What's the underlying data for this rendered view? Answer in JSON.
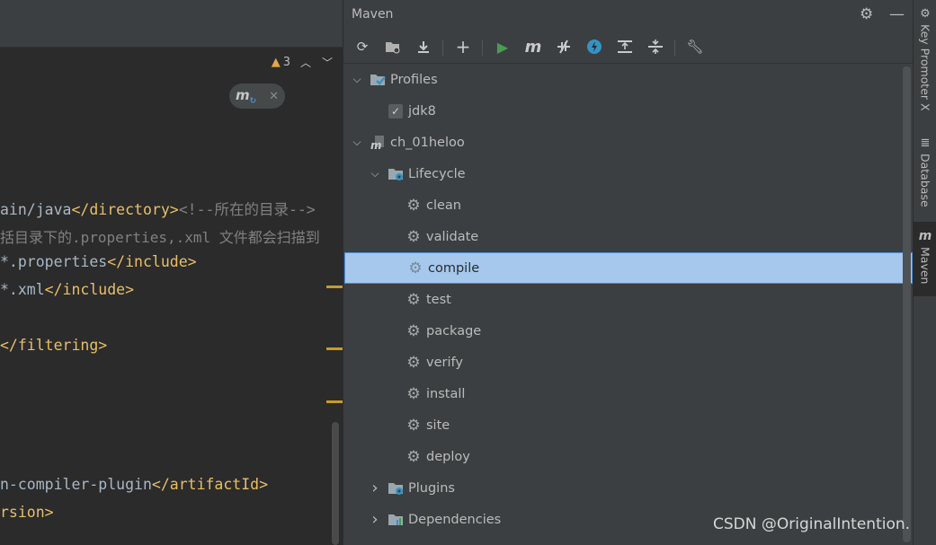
{
  "editor": {
    "warning_count": "3",
    "code_lines": [
      {
        "parts": [
          {
            "t": "ain/java",
            "c": ""
          },
          {
            "t": "</",
            "c": "br"
          },
          {
            "t": "directory",
            "c": "tag"
          },
          {
            "t": ">",
            "c": "br"
          },
          {
            "t": "<!--所在的目录-->",
            "c": "cm"
          }
        ]
      },
      {
        "parts": [
          {
            "t": "括目录下的.properties,.xml 文件都会扫描到",
            "c": "cm"
          }
        ]
      },
      {
        "parts": [
          {
            "t": "*.properties",
            "c": ""
          },
          {
            "t": "</",
            "c": "br"
          },
          {
            "t": "include",
            "c": "tag"
          },
          {
            "t": ">",
            "c": "br"
          }
        ]
      },
      {
        "parts": [
          {
            "t": "*.xml",
            "c": ""
          },
          {
            "t": "</",
            "c": "br"
          },
          {
            "t": "include",
            "c": "tag"
          },
          {
            "t": ">",
            "c": "br"
          }
        ]
      },
      {
        "parts": [
          {
            "t": "</",
            "c": "br"
          },
          {
            "t": "filtering",
            "c": "tag"
          },
          {
            "t": ">",
            "c": "br"
          }
        ]
      },
      {
        "parts": [
          {
            "t": "n-compiler-plugin",
            "c": ""
          },
          {
            "t": "</",
            "c": "br"
          },
          {
            "t": "artifactId",
            "c": "tag"
          },
          {
            "t": ">",
            "c": "br"
          }
        ]
      },
      {
        "parts": [
          {
            "t": "rsion",
            "c": "tag"
          },
          {
            "t": ">",
            "c": "br"
          }
        ]
      }
    ]
  },
  "maven": {
    "title": "Maven",
    "toolbar_icons": [
      "reload-icon",
      "add-maven-project-icon",
      "download-icon",
      "plus-icon",
      "run-icon",
      "execute-goal-icon",
      "toggle-offline-icon",
      "skip-tests-icon",
      "show-dependencies-icon",
      "collapse-all-icon",
      "settings-wrench-icon"
    ],
    "tree": [
      {
        "label": "Profiles",
        "icon": "profiles-icon",
        "arrow": "down",
        "indent": 0
      },
      {
        "label": "jdk8",
        "icon": "checkbox",
        "arrow": "",
        "indent": 1
      },
      {
        "label": "ch_01heloo",
        "icon": "maven-project-icon",
        "arrow": "down",
        "indent": 0
      },
      {
        "label": "Lifecycle",
        "icon": "folder-gear-icon",
        "arrow": "down",
        "indent": 1
      },
      {
        "label": "clean",
        "icon": "gear-icon",
        "arrow": "",
        "indent": 2
      },
      {
        "label": "validate",
        "icon": "gear-icon",
        "arrow": "",
        "indent": 2
      },
      {
        "label": "compile",
        "icon": "gear-icon",
        "arrow": "",
        "indent": 2,
        "selected": true
      },
      {
        "label": "test",
        "icon": "gear-icon",
        "arrow": "",
        "indent": 2
      },
      {
        "label": "package",
        "icon": "gear-icon",
        "arrow": "",
        "indent": 2
      },
      {
        "label": "verify",
        "icon": "gear-icon",
        "arrow": "",
        "indent": 2
      },
      {
        "label": "install",
        "icon": "gear-icon",
        "arrow": "",
        "indent": 2
      },
      {
        "label": "site",
        "icon": "gear-icon",
        "arrow": "",
        "indent": 2
      },
      {
        "label": "deploy",
        "icon": "gear-icon",
        "arrow": "",
        "indent": 2
      },
      {
        "label": "Plugins",
        "icon": "folder-gear-icon",
        "arrow": "right",
        "indent": 1
      },
      {
        "label": "Dependencies",
        "icon": "dependencies-icon",
        "arrow": "right",
        "indent": 1
      }
    ]
  },
  "stripe": {
    "tabs": [
      {
        "label": "Key Promoter X",
        "icon": "key-promoter-icon"
      },
      {
        "label": "Database",
        "icon": "database-icon"
      },
      {
        "label": "Maven",
        "icon": "maven-icon",
        "active": true
      }
    ]
  },
  "watermark": "CSDN @OriginalIntention.",
  "colors": {
    "selection": "#a5c8ec",
    "run_green": "#499c54",
    "accent_blue": "#3592c4",
    "warning": "#e0a84a",
    "tag": "#e8bf6a"
  }
}
